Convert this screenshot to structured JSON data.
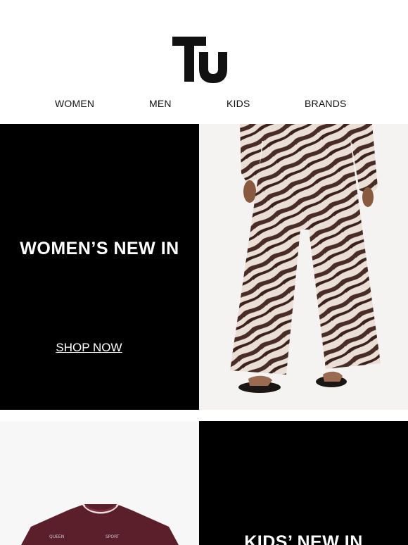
{
  "brand": {
    "logo_text": "Tu"
  },
  "nav": {
    "items": [
      {
        "label": "WOMEN"
      },
      {
        "label": "MEN"
      },
      {
        "label": "KIDS"
      },
      {
        "label": "BRANDS"
      }
    ]
  },
  "womens": {
    "title": "WOMEN’S NEW IN",
    "cta": "SHOP NOW",
    "image": "zebra-print-trousers-photo"
  },
  "kids": {
    "title": "KIDS’ NEW IN",
    "image": "burgundy-sweatshirt-photo"
  }
}
